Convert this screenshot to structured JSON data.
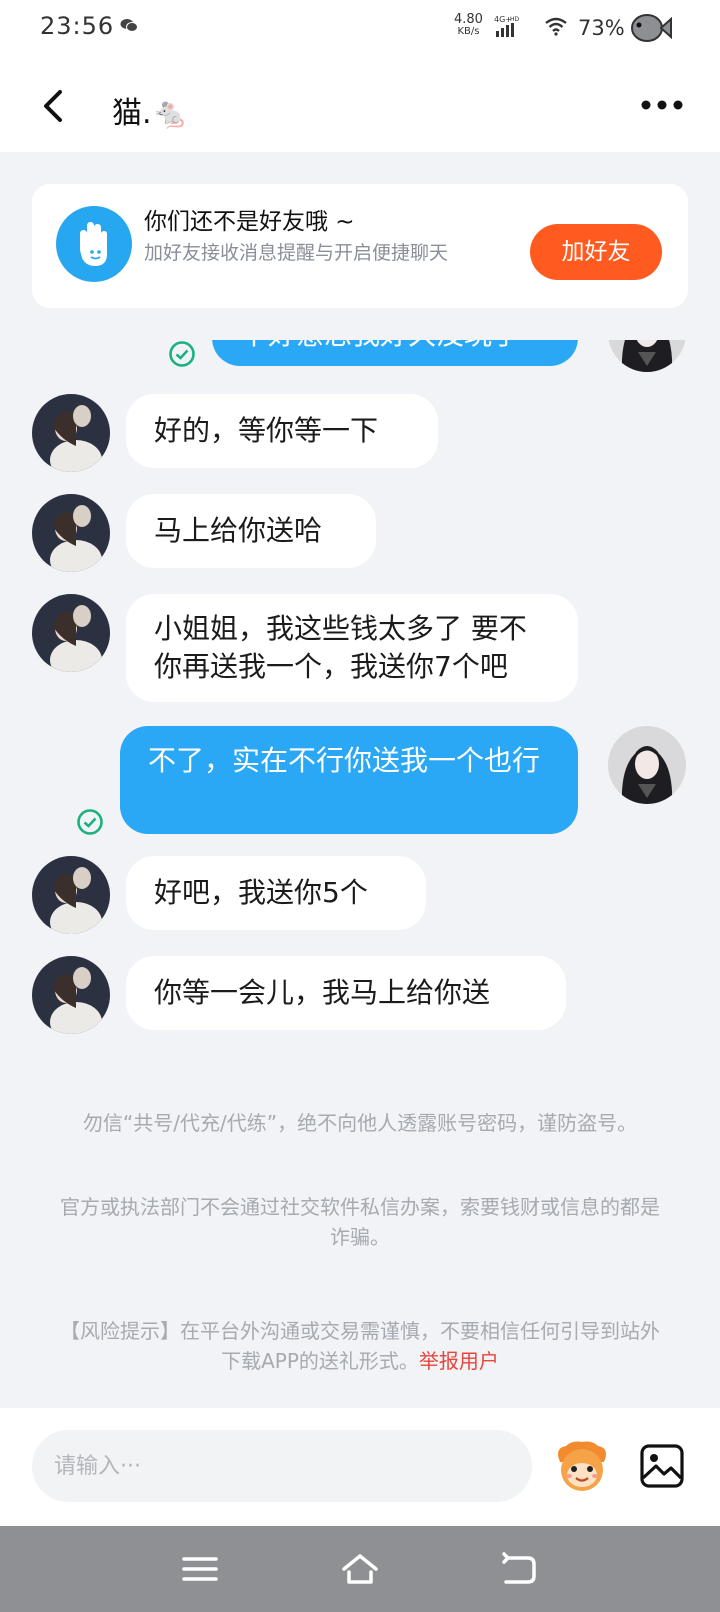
{
  "status_bar": {
    "time": "23:56",
    "speed_value": "4.80",
    "speed_unit": "KB/s",
    "network": "4G+",
    "network_hd": "HD",
    "battery": "73%"
  },
  "header": {
    "title": "猫.🐁"
  },
  "friend_card": {
    "title": "你们还不是好友哦 ~",
    "subtitle": "加好友接收消息提醒与开启便捷聊天",
    "button": "加好友"
  },
  "messages": [
    {
      "from": "me",
      "text": "不好意思我好久没玩了",
      "read": true
    },
    {
      "from": "them",
      "text": "好的，等你等一下"
    },
    {
      "from": "them",
      "text": "马上给你送哈"
    },
    {
      "from": "them",
      "text": "小姐姐，我这些钱太多了 要不你再送我一个，我送你7个吧"
    },
    {
      "from": "me",
      "text": "不了，实在不行你送我一个也行",
      "read": true
    },
    {
      "from": "them",
      "text": "好吧，我送你5个"
    },
    {
      "from": "them",
      "text": "你等一会儿，我马上给你送"
    }
  ],
  "notices": {
    "account_safety": "勿信“共号/代充/代练”，绝不向他人透露账号密码，谨防盗号。",
    "fraud_warning": "官方或执法部门不会通过社交软件私信办案，索要钱财或信息的都是诈骗。",
    "risk_prefix": "【风险提示】在平台外沟通或交易需谨慎，不要相信任何引导到站外下载APP的送礼形式。",
    "report_link": "举报用户"
  },
  "input": {
    "placeholder": "请输入···"
  },
  "icons": {
    "accent": "#2aa7f5",
    "add_button": "#ff5a1f",
    "read_check": "#19b27b"
  }
}
